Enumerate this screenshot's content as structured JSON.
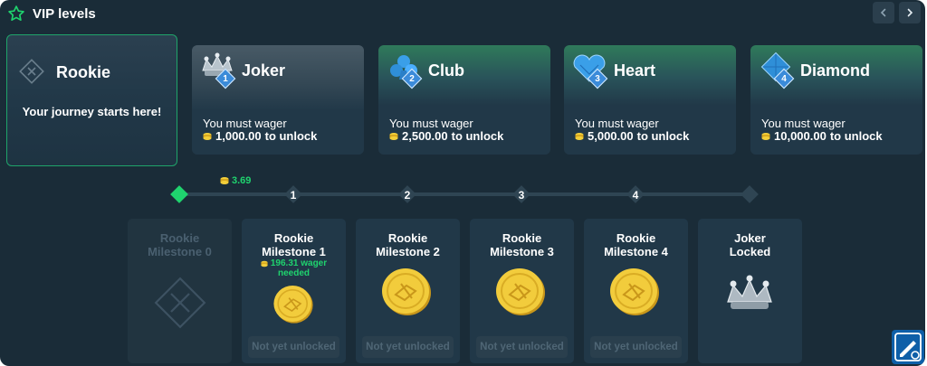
{
  "header": {
    "title": "VIP levels",
    "icon": "star-outline-icon"
  },
  "nav": {
    "prev_icon": "chevron-left-icon",
    "next_icon": "chevron-right-icon"
  },
  "levels": [
    {
      "name": "Rookie",
      "description": "Your journey starts here!",
      "icon": "x-diamond-icon"
    },
    {
      "name": "Joker",
      "badge": "1",
      "req_line1": "You must wager",
      "req_amount": "1,000.00",
      "req_suffix": "to unlock",
      "icon": "jester-crown-icon"
    },
    {
      "name": "Club",
      "badge": "2",
      "req_line1": "You must wager",
      "req_amount": "2,500.00",
      "req_suffix": "to unlock",
      "icon": "club-gem-icon"
    },
    {
      "name": "Heart",
      "badge": "3",
      "req_line1": "You must wager",
      "req_amount": "5,000.00",
      "req_suffix": "to unlock",
      "icon": "heart-gem-icon"
    },
    {
      "name": "Diamond",
      "badge": "4",
      "req_line1": "You must wager",
      "req_amount": "10,000.00",
      "req_suffix": "to unlock",
      "icon": "diamond-gem-icon"
    }
  ],
  "progress": {
    "amount": "3.69",
    "nodes": [
      "",
      "1",
      "2",
      "3",
      "4",
      ""
    ]
  },
  "milestones": [
    {
      "line1": "Rookie",
      "line2": "Milestone 0",
      "dim": true,
      "image": "x-diamond-icon"
    },
    {
      "line1": "Rookie",
      "line2": "Milestone 1",
      "need": "196.31 wager",
      "need2": "needed",
      "status": "Not yet unlocked",
      "image": "gold-coin-icon"
    },
    {
      "line1": "Rookie",
      "line2": "Milestone 2",
      "status": "Not yet unlocked",
      "image": "gold-coin-icon"
    },
    {
      "line1": "Rookie",
      "line2": "Milestone 3",
      "status": "Not yet unlocked",
      "image": "gold-coin-icon"
    },
    {
      "line1": "Rookie",
      "line2": "Milestone 4",
      "status": "Not yet unlocked",
      "image": "gold-coin-icon"
    },
    {
      "line1": "Joker",
      "line2": "Locked",
      "image": "jester-crown-icon"
    }
  ],
  "colors": {
    "background": "#1a2c38",
    "card": "#213848",
    "accent_green": "#1fd36e",
    "track": "#2f4553"
  }
}
